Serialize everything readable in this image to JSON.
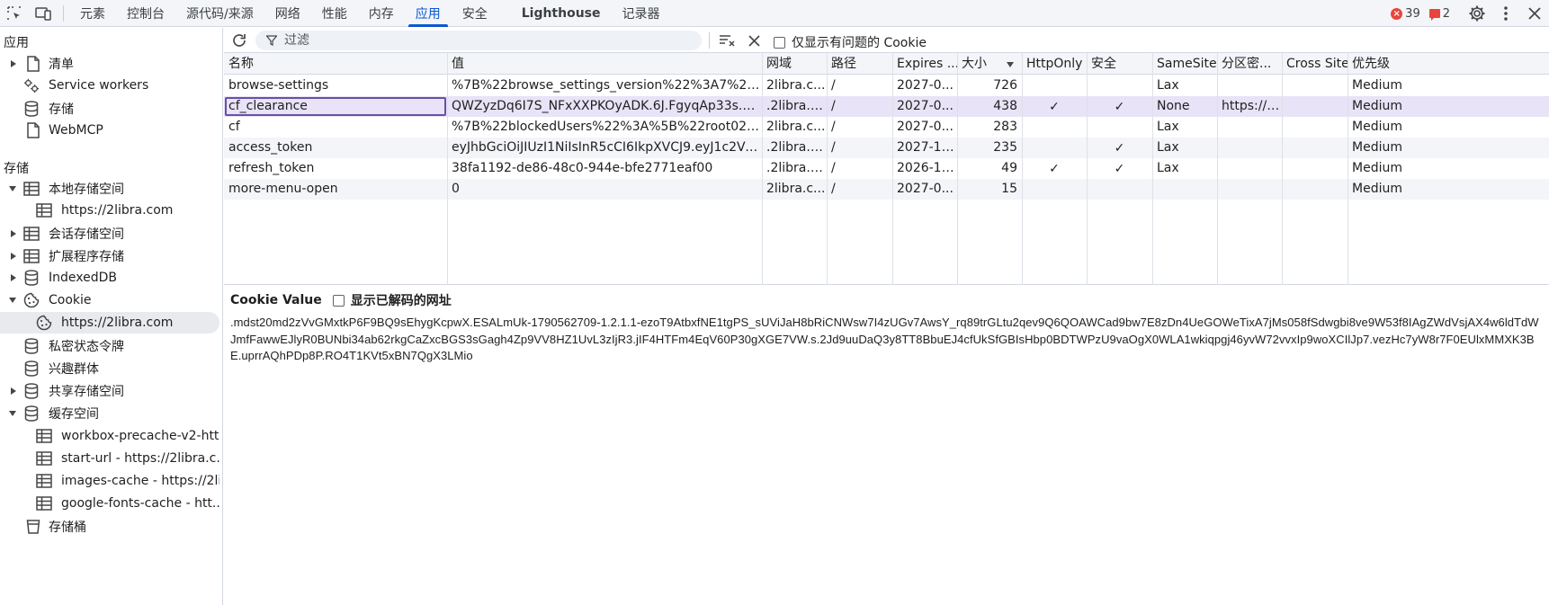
{
  "topbar": {
    "tabs": [
      {
        "label": "元素"
      },
      {
        "label": "控制台"
      },
      {
        "label": "源代码/来源"
      },
      {
        "label": "网络"
      },
      {
        "label": "性能"
      },
      {
        "label": "内存"
      },
      {
        "label": "应用"
      },
      {
        "label": "安全"
      },
      {
        "label": "Lighthouse"
      },
      {
        "label": "记录器"
      }
    ],
    "active_tab": "应用",
    "errors_count": "39",
    "issues_count": "2"
  },
  "sidebar": {
    "app_section_title": "应用",
    "app_items": [
      {
        "label": "清单"
      },
      {
        "label": "Service workers"
      },
      {
        "label": "存储"
      },
      {
        "label": "WebMCP"
      }
    ],
    "storage_section_title": "存储",
    "storage_items": [
      {
        "label": "本地存储空间"
      },
      {
        "label": "https://2libra.com"
      },
      {
        "label": "会话存储空间"
      },
      {
        "label": "扩展程序存储"
      },
      {
        "label": "IndexedDB"
      },
      {
        "label": "Cookie"
      },
      {
        "label": "https://2libra.com"
      },
      {
        "label": "私密状态令牌"
      },
      {
        "label": "兴趣群体"
      },
      {
        "label": "共享存储空间"
      },
      {
        "label": "缓存空间"
      },
      {
        "label": "workbox-precache-v2-htt..."
      },
      {
        "label": "start-url - https://2libra.c..."
      },
      {
        "label": "images-cache - https://2li..."
      },
      {
        "label": "google-fonts-cache - htt..."
      },
      {
        "label": "存储桶"
      }
    ]
  },
  "toolbar": {
    "filter_placeholder": "过滤",
    "only_issues_label": "仅显示有问题的 Cookie"
  },
  "table": {
    "headers": [
      "名称",
      "值",
      "网域",
      "路径",
      "Expires ...",
      "大小",
      "HttpOnly",
      "安全",
      "SameSite",
      "分区密...",
      "Cross Site",
      "优先级"
    ],
    "rows": [
      {
        "name": "browse-settings",
        "value": "%7B%22browse_settings_version%22%3A7%2C%22a...",
        "domain": "2libra.c...",
        "path": "/",
        "expires": "2027-0...",
        "size": "726",
        "httponly": false,
        "secure": false,
        "samesite": "Lax",
        "partition": "",
        "cross": "",
        "priority": "Medium"
      },
      {
        "name": "cf_clearance",
        "value": "QWZyzDq6I7S_NFxXXPKOyADK.6J.FgyqAp33s.QyY9s...",
        "domain": ".2libra.c...",
        "path": "/",
        "expires": "2027-0...",
        "size": "438",
        "httponly": true,
        "secure": true,
        "samesite": "None",
        "partition": "https://2...",
        "cross": "",
        "priority": "Medium"
      },
      {
        "name": "cf",
        "value": "%7B%22blockedUsers%22%3A%5B%22root02048%...",
        "domain": "2libra.c...",
        "path": "/",
        "expires": "2027-0...",
        "size": "283",
        "httponly": false,
        "secure": false,
        "samesite": "Lax",
        "partition": "",
        "cross": "",
        "priority": "Medium"
      },
      {
        "name": "access_token",
        "value": "eyJhbGciOiJIUzI1NiIsInR5cCI6IkpXVCJ9.eyJ1c2Vybm...",
        "domain": ".2libra.c...",
        "path": "/",
        "expires": "2027-11...",
        "size": "235",
        "httponly": false,
        "secure": true,
        "samesite": "Lax",
        "partition": "",
        "cross": "",
        "priority": "Medium"
      },
      {
        "name": "refresh_token",
        "value": "38fa1192-de86-48c0-944e-bfe2771eaf00",
        "domain": ".2libra.c...",
        "path": "/",
        "expires": "2026-12...",
        "size": "49",
        "httponly": true,
        "secure": true,
        "samesite": "Lax",
        "partition": "",
        "cross": "",
        "priority": "Medium"
      },
      {
        "name": "more-menu-open",
        "value": "0",
        "domain": "2libra.c...",
        "path": "/",
        "expires": "2027-0...",
        "size": "15",
        "httponly": false,
        "secure": false,
        "samesite": "",
        "partition": "",
        "cross": "",
        "priority": "Medium"
      }
    ],
    "selected_row": "cf_clearance",
    "sort_column": "大小",
    "check_mark": "✓"
  },
  "cookie_value": {
    "title": "Cookie Value",
    "decode_label": "显示已解码的网址",
    "text": ".mdst20md2zVvGMxtkP6F9BQ9sEhygKcpwX.ESALmUk-1790562709-1.2.1.1-ezoT9AtbxfNE1tgPS_sUViJaH8bRiCNWsw7I4zUGv7AwsY_rq89trGLtu2qev9Q6QOAWCad9bw7E8zDn4UeGOWeTixA7jMs058fSdwgbi8ve9W53f8IAgZWdVsjAX4w6ldTdWJmfFawwEJlyR0BUNbi34ab62rkgCaZxcBGS3sGagh4Zp9VV8HZ1UvL3zIjR3.jIF4HTFm4EqV60P30gXGE7VW.s.2Jd9uuDaQ3y8TT8BbuEJ4cfUkSfGBIsHbp0BDTWPzU9vaOgX0WLA1wkiqpgj46yvW72vvxIp9woXCIlJp7.vezHc7yW8r7F0EUlxMMXK3BE.uprrAQhPDp8P.RO4T1KVt5xBN7QgX3LMio"
  }
}
